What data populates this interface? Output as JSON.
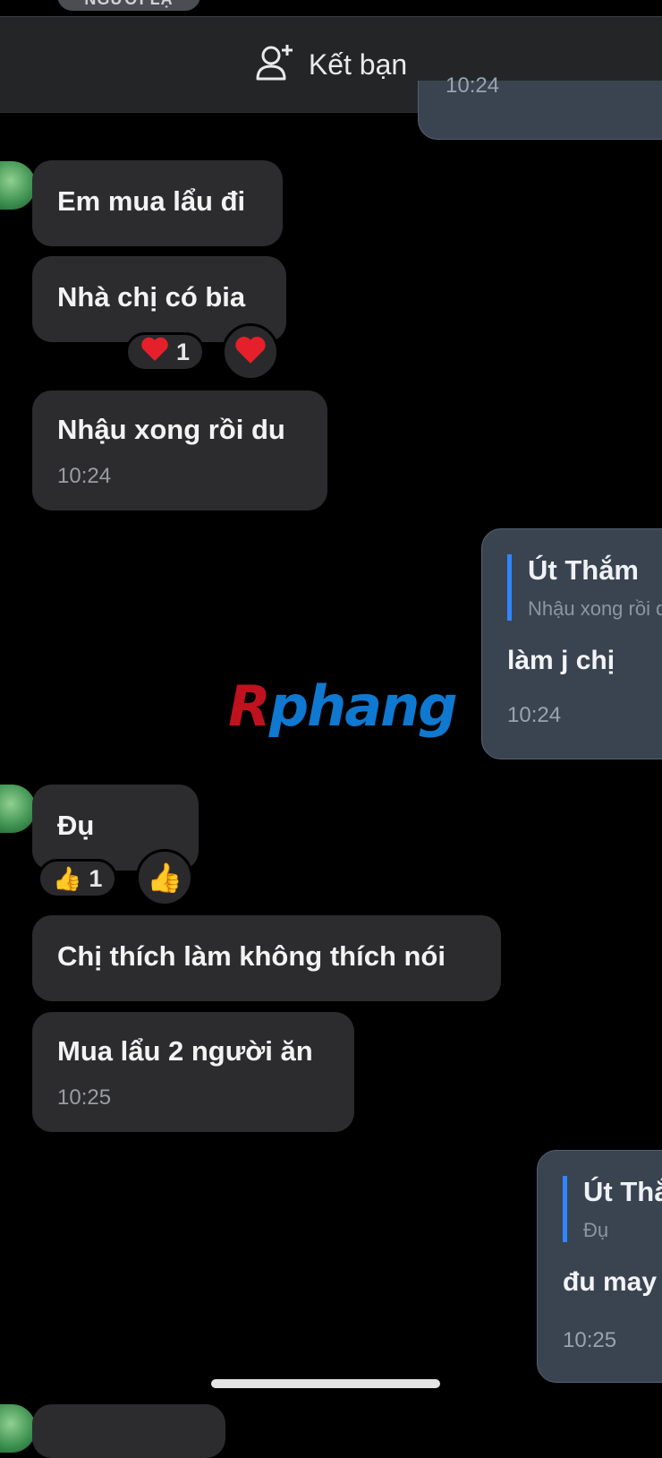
{
  "header": {
    "stranger_badge": "NGƯỜI LẠ",
    "add_friend_label": "Kết bạn"
  },
  "sent_top": {
    "time": "10:24"
  },
  "received": [
    {
      "text": "Em mua lẩu đi"
    },
    {
      "text": "Nhà chị có bia",
      "reaction_count": "1",
      "reaction": "heart"
    },
    {
      "text": "Nhậu xong rồi du",
      "time": "10:24"
    },
    {
      "text": "Đụ",
      "reaction_count": "1",
      "reaction": "thumbs-up"
    },
    {
      "text": "Chị thích làm không thích nói"
    },
    {
      "text": "Mua lẩu 2 người ăn",
      "time": "10:25"
    }
  ],
  "sent": [
    {
      "quote_name": "Út Thắm",
      "quote_text": "Nhậu xong rồi du",
      "text": "làm j chị",
      "time": "10:24"
    },
    {
      "quote_name": "Út Thắm",
      "quote_text": "Đụ",
      "text": "đu may",
      "time": "10:25"
    }
  ],
  "watermark": {
    "part1": "R",
    "part2": "phang"
  },
  "colors": {
    "background": "#000000",
    "received_bubble": "#2c2c2e",
    "sent_bubble": "#3a4350",
    "quote_bar": "#2f86ff"
  }
}
